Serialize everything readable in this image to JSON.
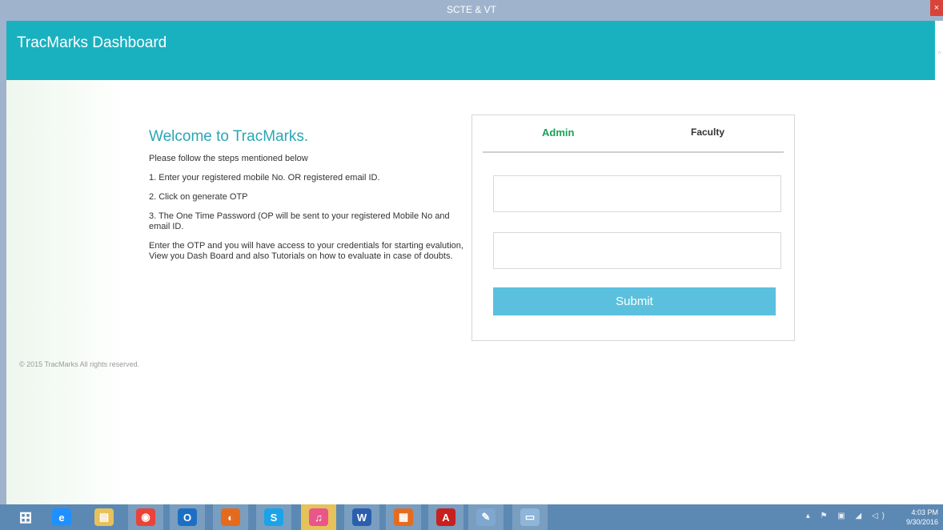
{
  "window": {
    "title": "SCTE & VT",
    "close_glyph": "×"
  },
  "header": {
    "brand": "TracMarks Dashboard"
  },
  "welcome": {
    "title": "Welcome to TracMarks.",
    "intro": "Please follow the steps mentioned below",
    "step1": "1. Enter your registered mobile No. OR registered email ID.",
    "step2": "2. Click on generate OTP",
    "step3": "3. The One Time Password (OP will be sent to your registered Mobile No and email ID.",
    "note": "Enter the OTP and you will have access to your credentials for starting evalution, View you Dash Board and also Tutorials on how to evaluate in case of doubts."
  },
  "login": {
    "tabs": [
      "Admin",
      "Faculty"
    ],
    "active_tab": "Admin",
    "field1_value": "",
    "field2_value": "",
    "submit_label": "Submit"
  },
  "footer": {
    "copyright": "© 2015 TracMarks All rights reserved."
  },
  "taskbar": {
    "apps": [
      {
        "name": "windows-start-icon",
        "glyph": "⊞",
        "color": "#ffffff"
      },
      {
        "name": "internet-explorer-icon",
        "glyph": "e",
        "color": "#1e90ff"
      },
      {
        "name": "file-explorer-icon",
        "glyph": "▤",
        "color": "#e8c15a"
      },
      {
        "name": "chrome-icon",
        "glyph": "◉",
        "color": "#e9443a"
      },
      {
        "name": "outlook-icon",
        "glyph": "O",
        "color": "#1d6fc4"
      },
      {
        "name": "firefox-icon",
        "glyph": "◐",
        "color": "#e66a1c"
      },
      {
        "name": "skype-icon",
        "glyph": "S",
        "color": "#1aa3e8"
      },
      {
        "name": "itunes-icon",
        "glyph": "♫",
        "color": "#e9568a"
      },
      {
        "name": "word-icon",
        "glyph": "W",
        "color": "#2b5fad"
      },
      {
        "name": "office-icon",
        "glyph": "▦",
        "color": "#e56b1f"
      },
      {
        "name": "acrobat-icon",
        "glyph": "A",
        "color": "#c8201f"
      },
      {
        "name": "paint-icon",
        "glyph": "✎",
        "color": "#7fa7cf"
      },
      {
        "name": "notepad-icon",
        "glyph": "▭",
        "color": "#8fb5d9"
      }
    ],
    "tray_icons": "▴ ⚑ ▣ ◢ ◁)",
    "time": "4:03 PM",
    "date": "9/30/2016"
  },
  "colors": {
    "header": "#19b1c0",
    "title_accent": "#2aa6b6",
    "admin_tab": "#1aa05a",
    "submit": "#5bc0de",
    "taskbar": "#5c89b3"
  }
}
